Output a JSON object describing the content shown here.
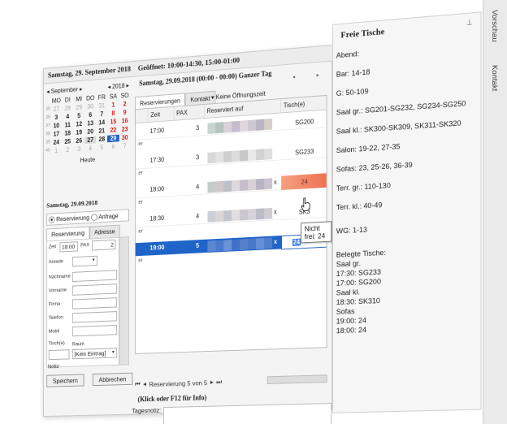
{
  "topbar": {
    "date": "Samstag, 29. September 2018",
    "hours": "Geöffnet: 10:00-14:30, 15:00-01:00"
  },
  "calendar": {
    "month": "September",
    "year": "2018",
    "weekdays": [
      "MO",
      "DI",
      "MI",
      "DO",
      "FR",
      "SA",
      "SO"
    ],
    "weeks": [
      {
        "wk": "35",
        "days": [
          "27",
          "28",
          "29",
          "30",
          "31",
          "1",
          "2"
        ]
      },
      {
        "wk": "36",
        "days": [
          "3",
          "4",
          "5",
          "6",
          "7",
          "8",
          "9"
        ]
      },
      {
        "wk": "37",
        "days": [
          "10",
          "11",
          "12",
          "13",
          "14",
          "15",
          "16"
        ]
      },
      {
        "wk": "38",
        "days": [
          "17",
          "18",
          "19",
          "20",
          "21",
          "22",
          "23"
        ]
      },
      {
        "wk": "39",
        "days": [
          "24",
          "25",
          "26",
          "27",
          "28",
          "29",
          "30"
        ]
      },
      {
        "wk": "40",
        "days": [
          "1",
          "2",
          "3",
          "4",
          "5",
          "6",
          "7"
        ]
      }
    ],
    "today_label": "Heute"
  },
  "left_panel": {
    "date_title": "Samstag, 29.09.2018",
    "radio_reservation": "Reservierung",
    "radio_request": "Anfrage",
    "tab_reservation": "Reservierung",
    "tab_address": "Adresse",
    "zeit_label": "Zeit",
    "zeit_value": "18:00",
    "pax_label": "PAX",
    "pax_value": "2",
    "anrede": "Anrede",
    "nachname": "Nachname",
    "vorname": "Vorname",
    "firma": "Firma",
    "telefon": "Telefon",
    "mobil": "Mobil",
    "tisch": "Tisch(e)",
    "raum": "Raum",
    "raum_value": "[Kein Eintrag]",
    "notiz": "Notiz",
    "save": "Speichern",
    "cancel": "Abbrechen"
  },
  "main": {
    "header": "Samstag, 29.09.2018 (00:00 - 00:00) Ganzer Tag",
    "tab_reservations": "Reservierungen",
    "tab_contact": "Kontakt",
    "no_opening": "Keine Öffnungszeit",
    "columns": [
      "Zeit",
      "PAX",
      "Reserviert auf",
      "Tisch(e)"
    ],
    "rows": [
      {
        "time": "17:00",
        "pax": "3",
        "table": "SG200"
      },
      {
        "time": "17:30",
        "pax": "3",
        "table": "SG233"
      },
      {
        "time": "18:00",
        "pax": "4",
        "table": "24"
      },
      {
        "time": "18:30",
        "pax": "4",
        "table": "SK3"
      },
      {
        "time": "19:00",
        "pax": "5",
        "table": "24"
      }
    ],
    "subrow_label": "er",
    "x_mark": "x",
    "tooltip": "Nicht frei: 24",
    "pager": "Reservierung 5 von 5",
    "info_hint": "(Klick oder F12 für Info)",
    "tagesnotiz": "Tagesnotiz:"
  },
  "side": {
    "title": "Freie Tische",
    "lines": [
      "Abend:",
      "Bar: 14-18",
      "G: 50-109",
      "Saal gr.: SG201-SG232, SG234-SG250",
      "Saal kl.: SK300-SK309, SK311-SK320",
      "Salon: 19-22, 27-35",
      "Sofas: 23, 25-26, 36-39",
      "Terr. gr.: 110-130",
      "Terr. kl.: 40-49",
      "WG: 1-13",
      "Belegte Tische:",
      "Saal gr.",
      "17:30: SG233",
      "17:00: SG200",
      "Saal kl.",
      "18:30: SK310",
      "Sofas",
      "19:00: 24",
      "18:00: 24"
    ]
  },
  "vtabs": {
    "preview": "Vorschau",
    "contact": "Kontakt"
  },
  "colors": {
    "selection": "#1f64c8",
    "weekend_red": "#d11111",
    "conflict": "#f07050"
  }
}
